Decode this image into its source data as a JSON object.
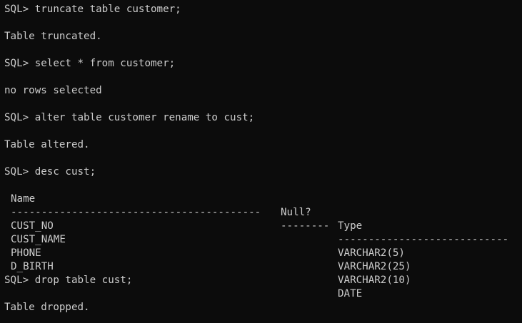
{
  "colors": {
    "background": "#0c0c0c",
    "text": "#cccccc"
  },
  "session": [
    {
      "prompt": "SQL> ",
      "command": "truncate table customer;"
    },
    {
      "output": "Table truncated."
    },
    {
      "prompt": "SQL> ",
      "command": "select * from customer;"
    },
    {
      "output": "no rows selected"
    },
    {
      "prompt": "SQL> ",
      "command": "alter table customer rename to cust;"
    },
    {
      "output": "Table altered."
    },
    {
      "prompt": "SQL> ",
      "command": "desc cust;"
    }
  ],
  "describe": {
    "headers": {
      "name": "Name",
      "null": "Null?",
      "type": "Type"
    },
    "rules": {
      "name": "-----------------------------------------",
      "null": "--------",
      "type": "----------------------------"
    },
    "rows": [
      {
        "name": "CUST_NO",
        "null": "",
        "type": "VARCHAR2(5)"
      },
      {
        "name": "CUST_NAME",
        "null": "",
        "type": "VARCHAR2(25)"
      },
      {
        "name": "PHONE",
        "null": "",
        "type": "VARCHAR2(10)"
      },
      {
        "name": "D_BIRTH",
        "null": "",
        "type": "DATE"
      }
    ]
  },
  "tail": [
    {
      "prompt": "SQL> ",
      "command": "drop table cust;"
    },
    {
      "output": "Table dropped."
    }
  ]
}
